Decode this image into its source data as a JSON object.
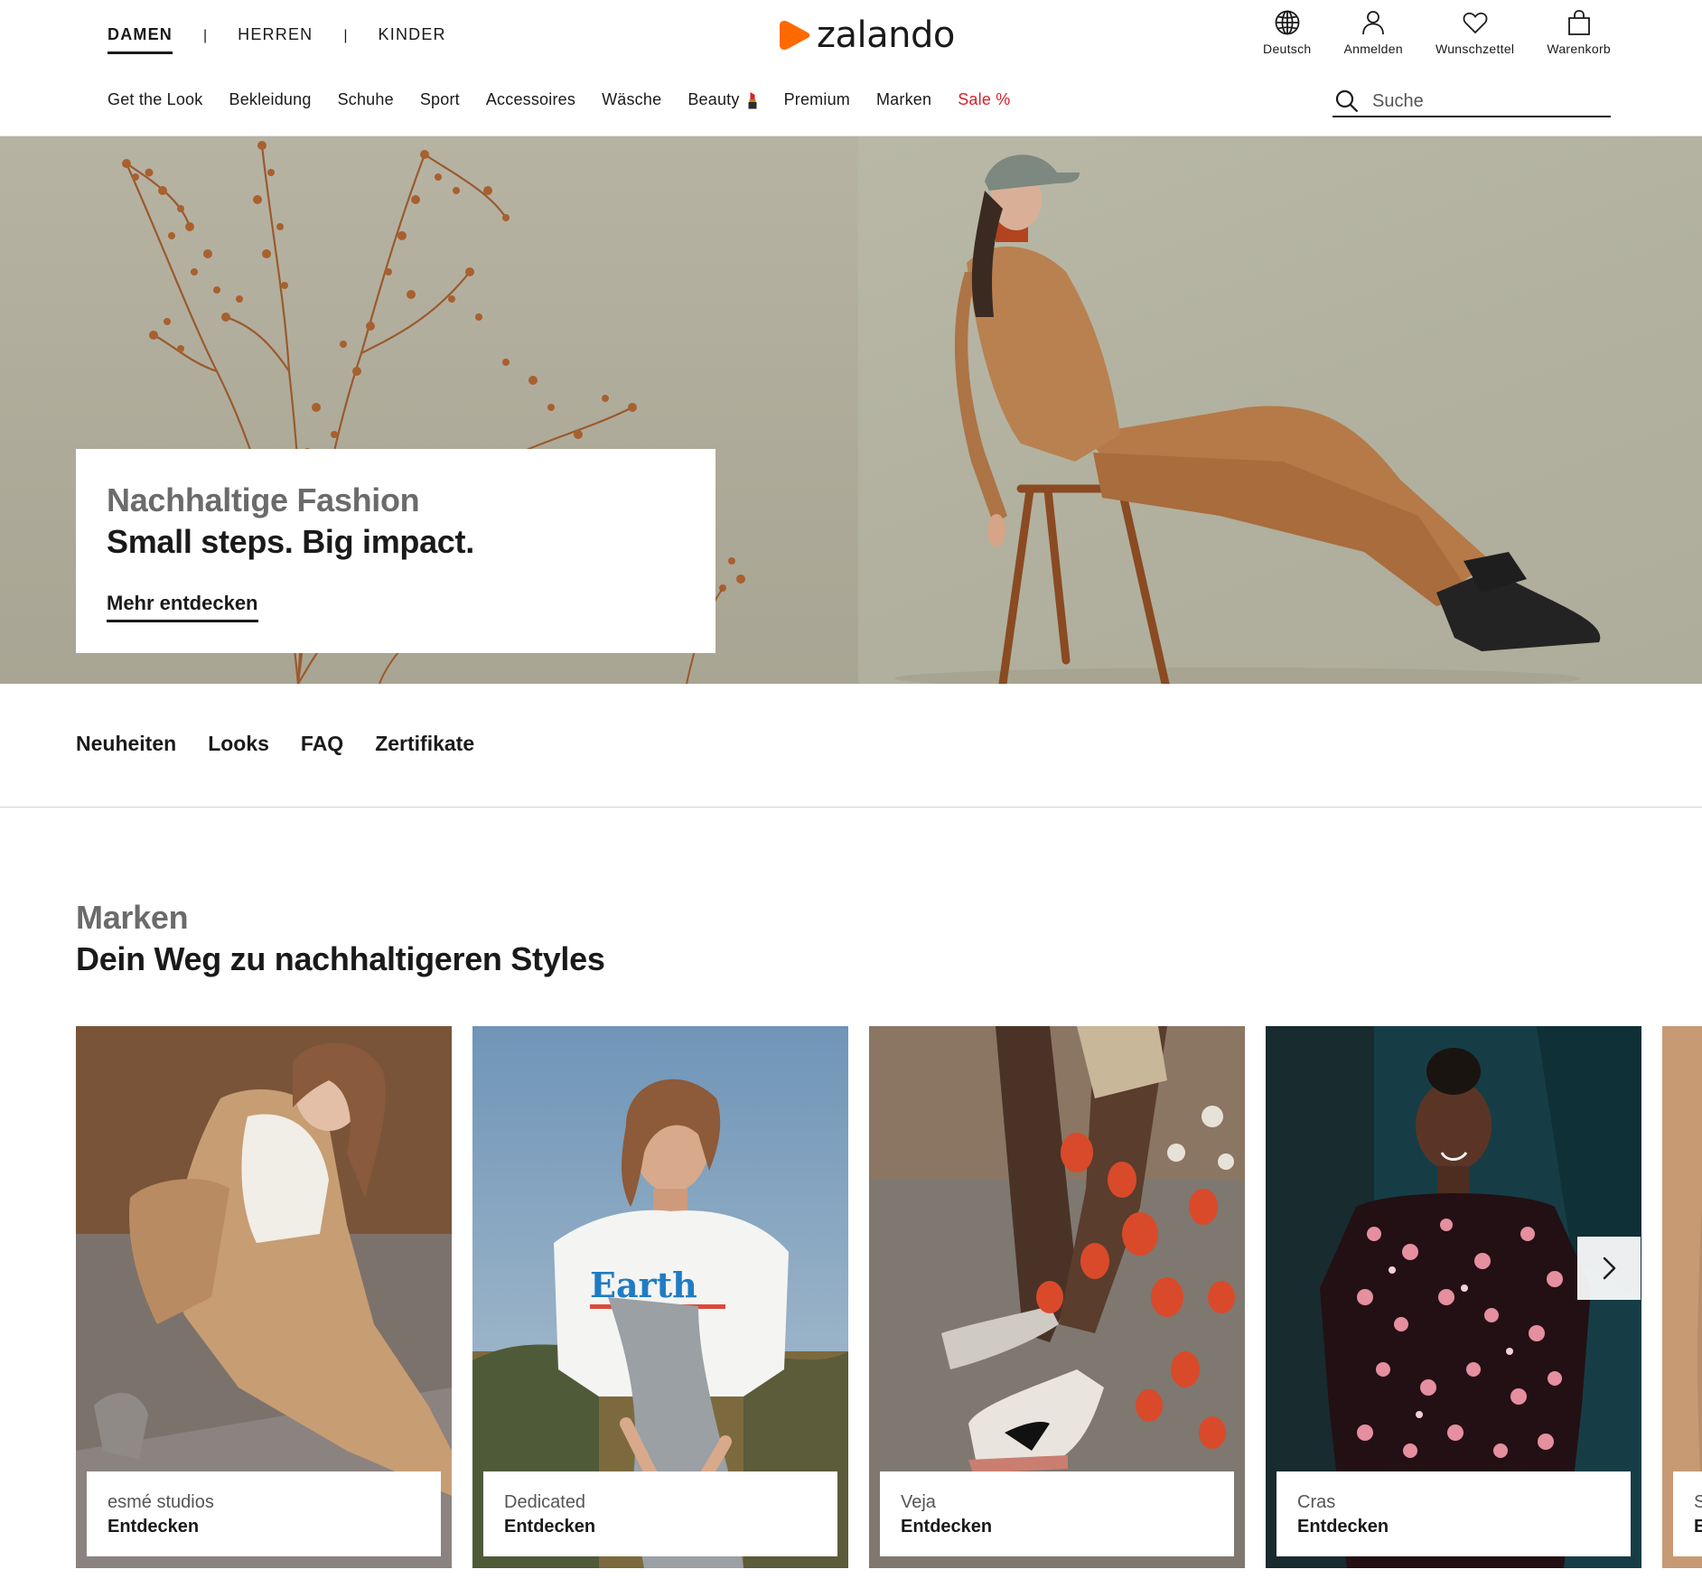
{
  "header": {
    "gender_tabs": [
      {
        "label": "DAMEN",
        "active": true
      },
      {
        "label": "HERREN",
        "active": false
      },
      {
        "label": "KINDER",
        "active": false
      }
    ],
    "separator": "|",
    "logo_text": "zalando",
    "utility": [
      {
        "label": "Deutsch",
        "icon": "globe-icon"
      },
      {
        "label": "Anmelden",
        "icon": "user-icon"
      },
      {
        "label": "Wunschzettel",
        "icon": "heart-icon"
      },
      {
        "label": "Warenkorb",
        "icon": "bag-icon"
      }
    ]
  },
  "nav": {
    "categories": [
      "Get the Look",
      "Bekleidung",
      "Schuhe",
      "Sport",
      "Accessoires",
      "Wäsche",
      "Beauty",
      "Premium",
      "Marken",
      "Sale %"
    ],
    "search_placeholder": "Suche"
  },
  "hero": {
    "kicker": "Nachhaltige Fashion",
    "title": "Small steps. Big impact.",
    "cta": "Mehr entdecken"
  },
  "subnav": [
    "Neuheiten",
    "Looks",
    "FAQ",
    "Zertifikate"
  ],
  "brands": {
    "kicker": "Marken",
    "title": "Dein Weg zu nachhaltigeren Styles",
    "cards": [
      {
        "brand": "esmé studios",
        "cta": "Entdecken"
      },
      {
        "brand": "Dedicated",
        "cta": "Entdecken"
      },
      {
        "brand": "Veja",
        "cta": "Entdecken"
      },
      {
        "brand": "Cras",
        "cta": "Entdecken"
      },
      {
        "brand": "S",
        "cta": "E"
      }
    ]
  },
  "colors": {
    "brand_orange": "#ff6900",
    "sale_red": "#d81e28",
    "text": "#1a1a1a",
    "kicker_grey": "#6b6b6b"
  }
}
